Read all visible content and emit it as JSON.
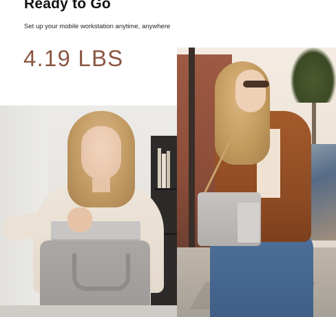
{
  "hero": {
    "headline": "Ready to Go",
    "subtitle": "Set up your mobile workstation anytime, anywhere",
    "weight": "4.19 LBS"
  },
  "colors": {
    "weight_text": "#8a5742",
    "headline_text": "#111111"
  }
}
